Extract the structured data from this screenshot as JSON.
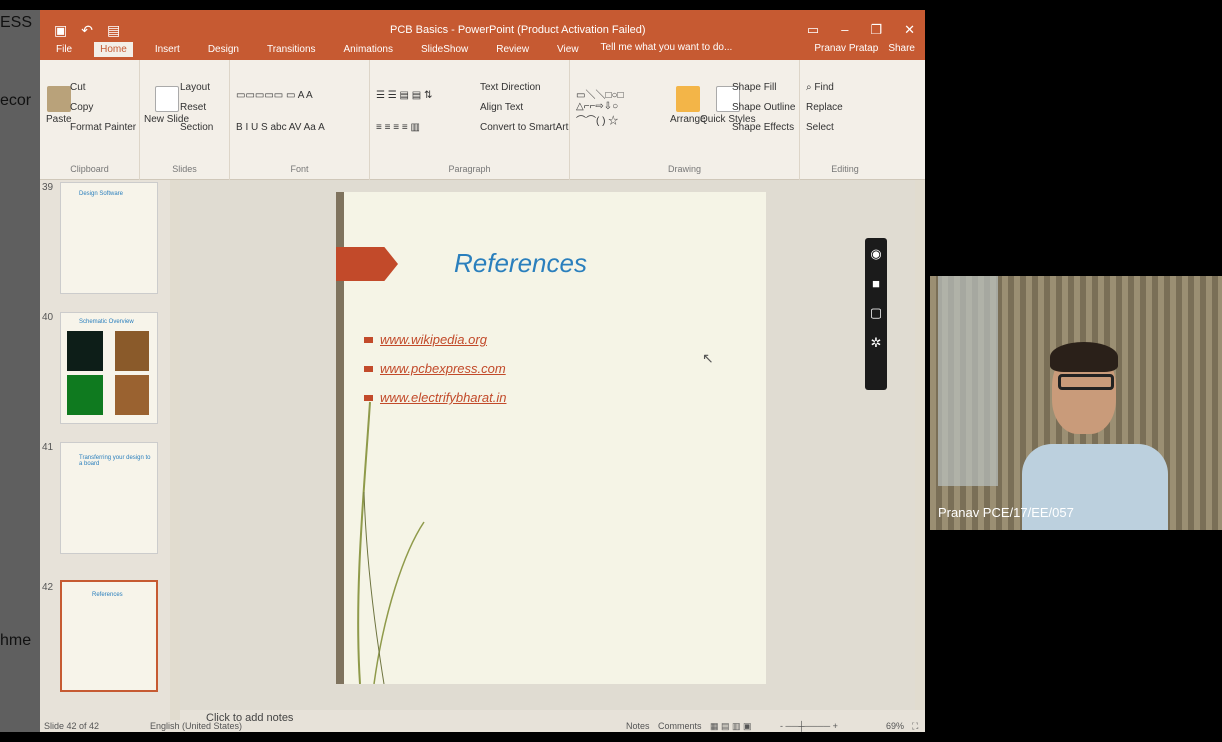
{
  "background": {
    "left_text_top": "ESS",
    "left_text_mid": "ecor",
    "left_text_low": "hme"
  },
  "window": {
    "title": "PCB Basics - PowerPoint (Product Activation Failed)",
    "user": "Pranav Pratap",
    "share": "Share"
  },
  "tabs": [
    "File",
    "Home",
    "Insert",
    "Design",
    "Transitions",
    "Animations",
    "SlideShow",
    "Review",
    "View"
  ],
  "tellme": "Tell me what you want to do...",
  "ribbon": {
    "clipboard": {
      "paste": "Paste",
      "cut": "Cut",
      "copy": "Copy",
      "format_painter": "Format Painter",
      "label": "Clipboard"
    },
    "slides": {
      "new_slide": "New Slide",
      "layout": "Layout",
      "reset": "Reset",
      "section": "Section",
      "label": "Slides"
    },
    "font": {
      "label": "Font"
    },
    "paragraph": {
      "text_direction": "Text Direction",
      "align_text": "Align Text",
      "smartart": "Convert to SmartArt",
      "label": "Paragraph"
    },
    "drawing": {
      "arrange": "Arrange",
      "quick_styles": "Quick Styles",
      "shape_fill": "Shape Fill",
      "shape_outline": "Shape Outline",
      "shape_effects": "Shape Effects",
      "label": "Drawing"
    },
    "editing": {
      "find": "Find",
      "replace": "Replace",
      "select": "Select",
      "label": "Editing"
    }
  },
  "thumbnails": [
    {
      "num": "39",
      "title": "Design Software"
    },
    {
      "num": "40",
      "title": "Schematic Overview"
    },
    {
      "num": "41",
      "title": "Transferring your design to a board"
    },
    {
      "num": "42",
      "title": "References"
    }
  ],
  "slide": {
    "title": "References",
    "links": [
      "www.wikipedia.org",
      "www.pcbexpress.com",
      "www.electrifybharat.in"
    ]
  },
  "notes_placeholder": "Click to add notes",
  "status": {
    "slide": "Slide 42 of 42",
    "language": "English (United States)",
    "notes": "Notes",
    "comments": "Comments",
    "zoom": "69%"
  },
  "video": {
    "name": "Pranav PCE/17/EE/057"
  }
}
